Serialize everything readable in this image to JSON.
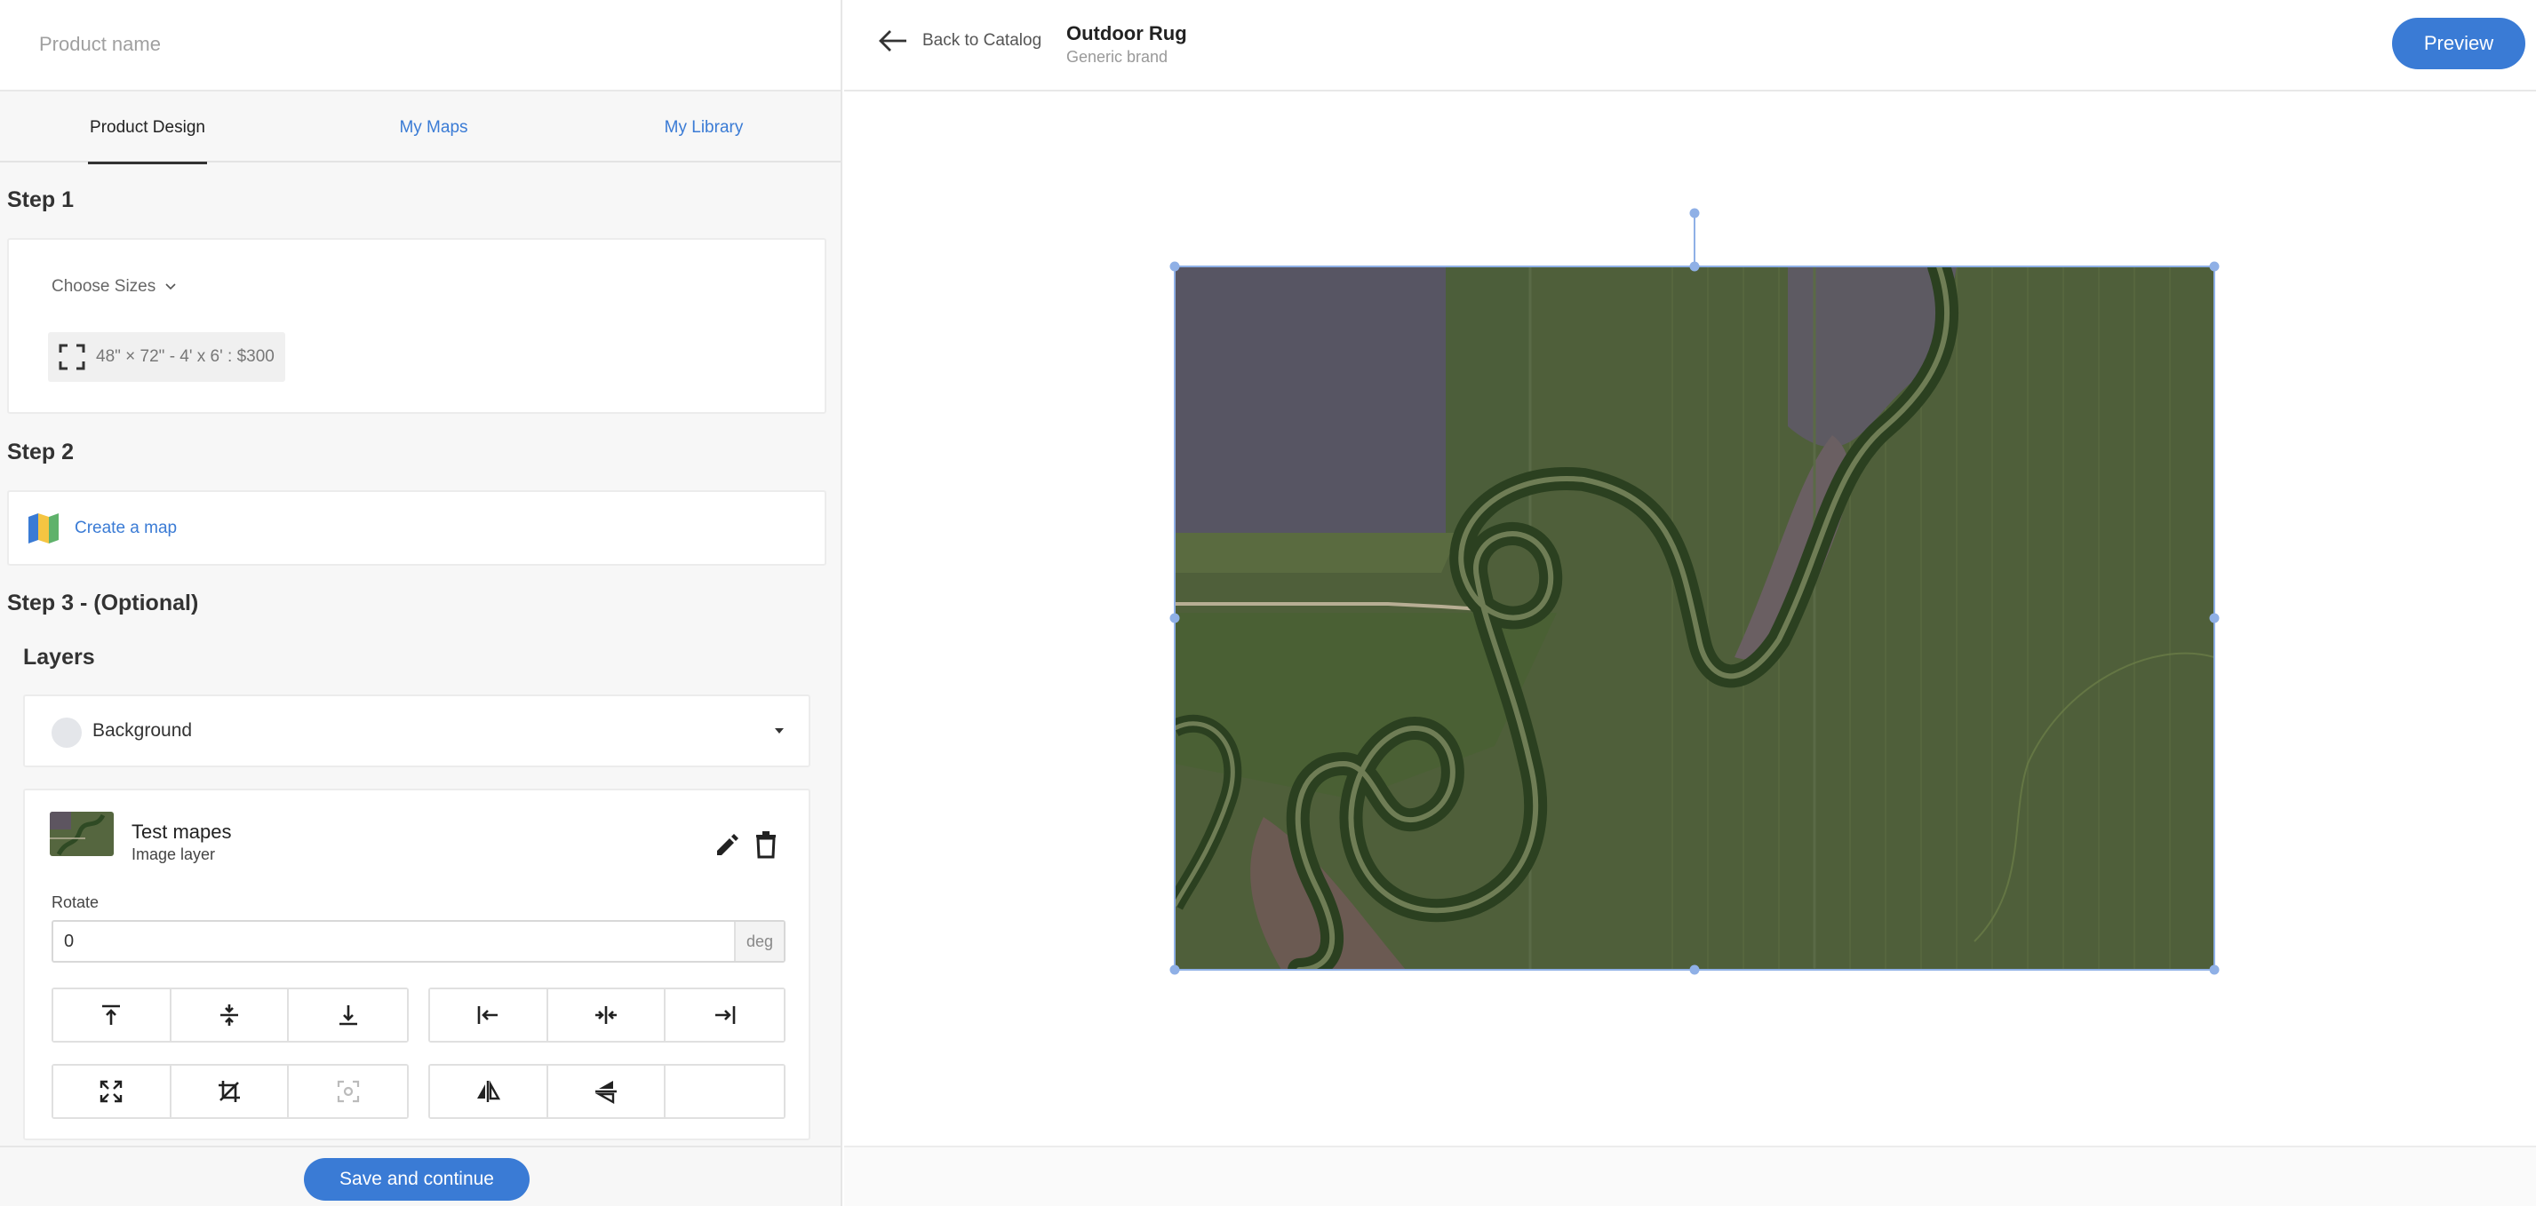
{
  "product_name": {
    "placeholder": "Product name"
  },
  "tabs": [
    {
      "label": "Product Design",
      "active": true
    },
    {
      "label": "My Maps",
      "active": false
    },
    {
      "label": "My Library",
      "active": false
    }
  ],
  "step1": {
    "title": "Step 1",
    "choose_sizes_label": "Choose Sizes",
    "size_option": "48\" × 72\" - 4' x 6' : $300"
  },
  "step2": {
    "title": "Step 2",
    "create_map_label": "Create a map"
  },
  "step3": {
    "title": "Step 3 - (Optional)",
    "layers_title": "Layers",
    "background_label": "Background",
    "layer": {
      "name": "Test mapes",
      "type": "Image layer",
      "rotate_label": "Rotate",
      "rotate_value": "0",
      "rotate_unit": "deg"
    }
  },
  "tools": {
    "row1_left": [
      "align-top-icon",
      "align-vertical-center-icon",
      "align-bottom-icon"
    ],
    "row1_right": [
      "align-left-icon",
      "align-horizontal-center-icon",
      "align-right-icon"
    ],
    "row2_left": [
      "fit-expand-icon",
      "crop-icon",
      "focus-icon"
    ],
    "row2_right": [
      "flip-horizontal-icon",
      "flip-vertical-icon"
    ]
  },
  "footer": {
    "save_label": "Save and continue"
  },
  "header": {
    "back_label": "Back to Catalog",
    "product_title": "Outdoor Rug",
    "brand": "Generic brand",
    "preview_label": "Preview"
  },
  "colors": {
    "accent": "#3a7bd5",
    "selection": "#8fb0e6",
    "panel_bg": "#f7f7f7"
  }
}
